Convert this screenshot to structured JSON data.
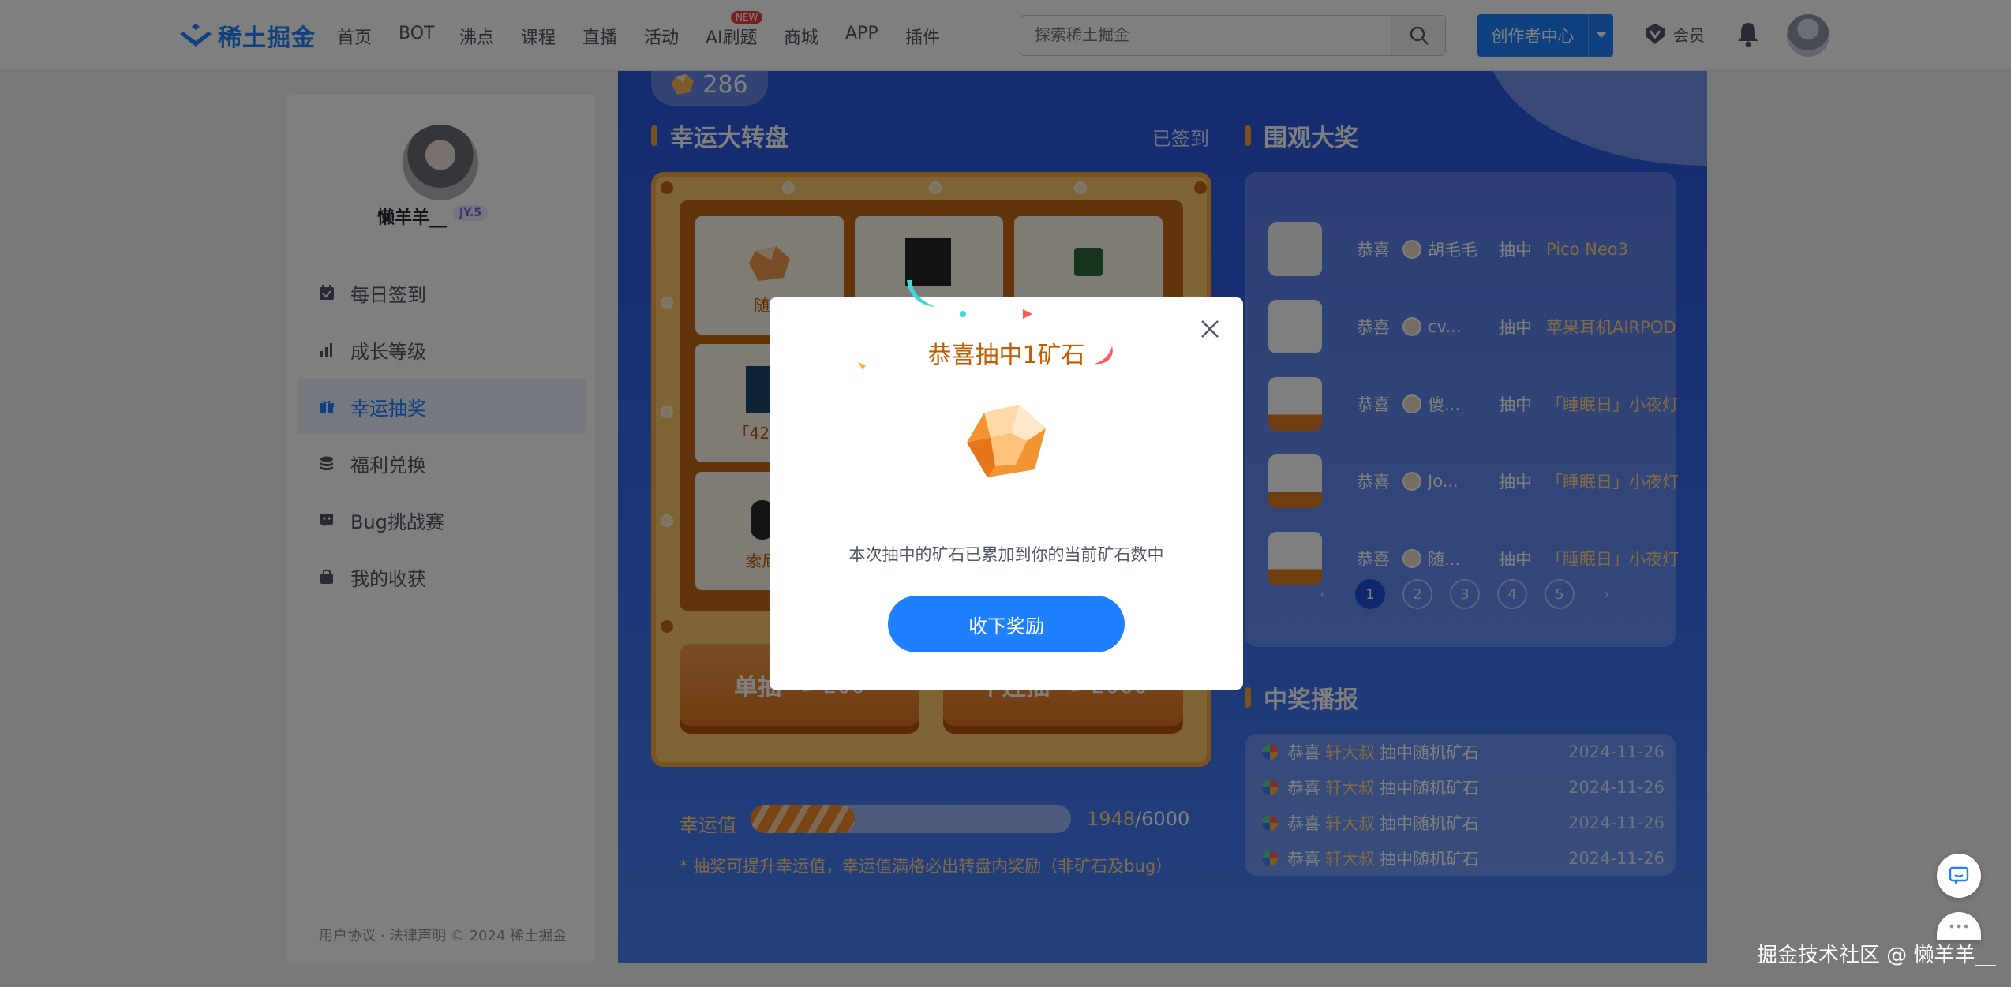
{
  "app": {
    "logo_text": "稀土掘金"
  },
  "nav": {
    "items": [
      "首页",
      "BOT",
      "沸点",
      "课程",
      "直播",
      "活动",
      "AI刷题",
      "商城",
      "APP",
      "插件"
    ],
    "new_badge": "NEW",
    "search_placeholder": "探索稀土掘金",
    "creator_label": "创作者中心",
    "vip_label": "会员"
  },
  "sidebar": {
    "username": "懒羊羊__",
    "level": "JY.5",
    "items": [
      {
        "label": "每日签到",
        "icon": "calendar-check-icon"
      },
      {
        "label": "成长等级",
        "icon": "bar-chart-icon"
      },
      {
        "label": "幸运抽奖",
        "icon": "gift-icon",
        "active": true
      },
      {
        "label": "福利兑换",
        "icon": "coins-icon"
      },
      {
        "label": "Bug挑战赛",
        "icon": "bug-icon"
      },
      {
        "label": "我的收获",
        "icon": "bag-icon"
      }
    ],
    "footer": "用户协议 · 法律声明 © 2024 稀土掘金"
  },
  "lottery": {
    "ore_count": "286",
    "title": "幸运大转盘",
    "signed_status": "已签到",
    "cells": [
      {
        "label": "随机"
      },
      {
        "label": ""
      },
      {
        "label": ""
      },
      {
        "label": "「4201」"
      },
      {
        "label": "索尼降"
      }
    ],
    "single_draw": {
      "label": "单抽",
      "cost": "200"
    },
    "ten_draw": {
      "label": "十连抽",
      "cost": "2000"
    },
    "luck_label": "幸运值",
    "luck_value": "1948",
    "luck_max": "/6000",
    "luck_progress": 0.325,
    "luck_note": "* 抽奖可提升幸运值，幸运值满格必出转盘内奖励（非矿石及bug）"
  },
  "watch": {
    "title": "围观大奖",
    "rows": [
      {
        "congrats": "恭喜",
        "user": "胡毛毛",
        "draw": "抽中",
        "prize": "Pico Neo3"
      },
      {
        "congrats": "恭喜",
        "user": "cv...",
        "draw": "抽中",
        "prize": "苹果耳机AIRPOD"
      },
      {
        "congrats": "恭喜",
        "user": "傻...",
        "draw": "抽中",
        "prize": "「睡眠日」小夜灯"
      },
      {
        "congrats": "恭喜",
        "user": "Jo...",
        "draw": "抽中",
        "prize": "「睡眠日」小夜灯"
      },
      {
        "congrats": "恭喜",
        "user": "随...",
        "draw": "抽中",
        "prize": "「睡眠日」小夜灯"
      }
    ],
    "pages": [
      "‹",
      "1",
      "2",
      "3",
      "4",
      "5",
      "›"
    ],
    "current_page": "1"
  },
  "broadcast": {
    "title": "中奖播报",
    "rows": [
      {
        "congrats": "恭喜",
        "user": "轩大叔",
        "text": "抽中随机矿石",
        "date": "2024-11-26"
      },
      {
        "congrats": "恭喜",
        "user": "轩大叔",
        "text": "抽中随机矿石",
        "date": "2024-11-26"
      },
      {
        "congrats": "恭喜",
        "user": "轩大叔",
        "text": "抽中随机矿石",
        "date": "2024-11-26"
      },
      {
        "congrats": "恭喜",
        "user": "轩大叔",
        "text": "抽中随机矿石",
        "date": "2024-11-26"
      }
    ]
  },
  "modal": {
    "title": "恭喜抽中1矿石",
    "description": "本次抽中的矿石已累加到你的当前矿石数中",
    "button_label": "收下奖励"
  },
  "watermark": "掘金技术社区 @ 懒羊羊__",
  "colors": {
    "brand": "#1e80ff",
    "lottery_orange": "#c65b00",
    "panel_blue": "#2a57e0",
    "gold": "#ffd38f"
  }
}
